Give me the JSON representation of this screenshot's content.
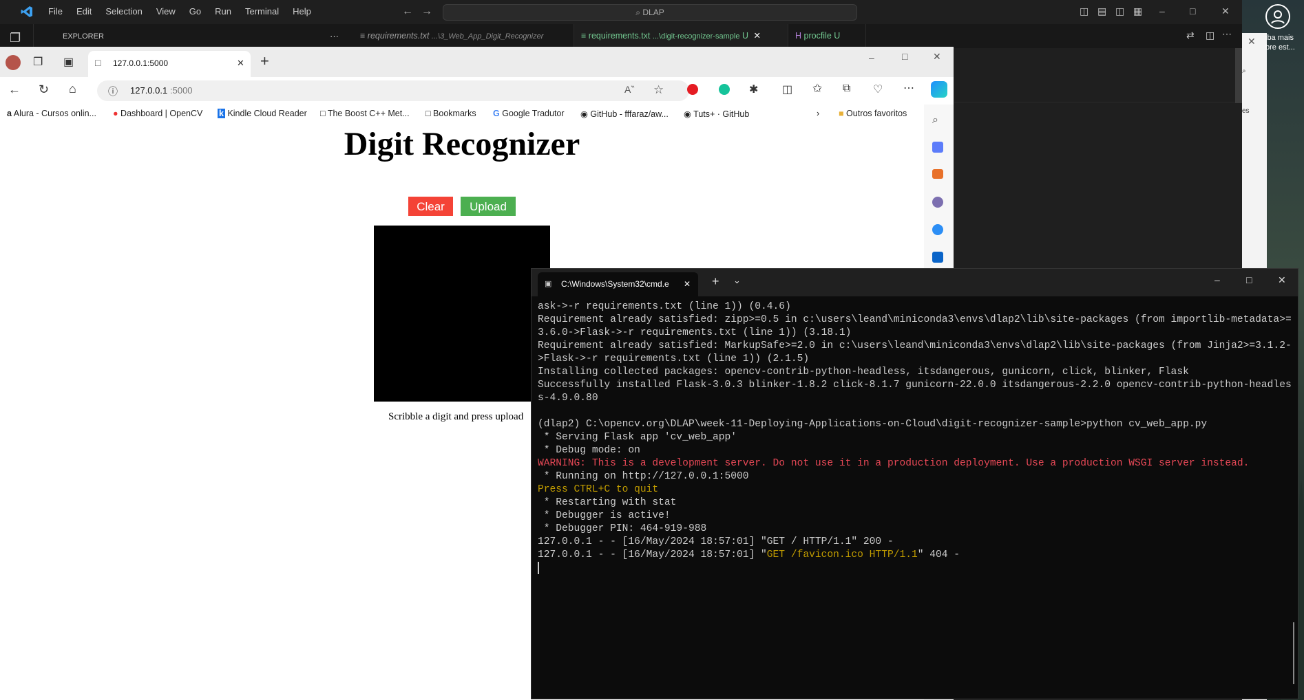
{
  "vscode": {
    "menu": [
      "File",
      "Edit",
      "Selection",
      "View",
      "Go",
      "Run",
      "Terminal",
      "Help"
    ],
    "search_text": "DLAP",
    "sidebar_title": "EXPLORER",
    "sidebar_more": "···",
    "tabs": [
      {
        "name": "requirements.txt",
        "path": "...\\3_Web_App_Digit_Recognizer",
        "status": ""
      },
      {
        "name": "requirements.txt",
        "path": "...\\digit-recognizer-sample",
        "status": "U"
      },
      {
        "name": "procfile",
        "path": "",
        "status": "U"
      }
    ],
    "accent_color": "#3ca0f0",
    "git_color": "#73c991"
  },
  "side_window": {
    "text_line1": "iba mais",
    "text_line2": "bre est...",
    "partial": "es"
  },
  "edge": {
    "tab_title": "127.0.0.1:5000",
    "url_host": "127.0.0.1",
    "url_port": ":5000",
    "bookmarks": [
      {
        "label": "Alura - Cursos onlin...",
        "icon": "alura-icon"
      },
      {
        "label": "Dashboard | OpenCV",
        "icon": "opencv-icon"
      },
      {
        "label": "Kindle Cloud Reader",
        "icon": "kindle-icon"
      },
      {
        "label": "The Boost C++ Met...",
        "icon": "page-icon"
      },
      {
        "label": "Bookmarks",
        "icon": "page-icon"
      },
      {
        "label": "Google Tradutor",
        "icon": "translate-icon"
      },
      {
        "label": "GitHub - fffaraz/aw...",
        "icon": "github-icon"
      },
      {
        "label": "Tuts+ · GitHub",
        "icon": "github-icon"
      }
    ],
    "other_favorites": "Outros favoritos"
  },
  "page": {
    "title": "Digit Recognizer",
    "clear_label": "Clear",
    "upload_label": "Upload",
    "hint": "Scribble a digit and press upload",
    "clear_color": "#f44336",
    "upload_color": "#4caf50"
  },
  "cmd": {
    "tab_title": "C:\\Windows\\System32\\cmd.e",
    "lines": [
      {
        "text": "ask->-r requirements.txt (line 1)) (0.4.6)",
        "type": "normal"
      },
      {
        "text": "Requirement already satisfied: zipp>=0.5 in c:\\users\\leand\\miniconda3\\envs\\dlap2\\lib\\site-packages (from importlib-metadata>=3.6.0->Flask->-r requirements.txt (line 1)) (3.18.1)",
        "type": "normal"
      },
      {
        "text": "Requirement already satisfied: MarkupSafe>=2.0 in c:\\users\\leand\\miniconda3\\envs\\dlap2\\lib\\site-packages (from Jinja2>=3.1.2->Flask->-r requirements.txt (line 1)) (2.1.5)",
        "type": "normal"
      },
      {
        "text": "Installing collected packages: opencv-contrib-python-headless, itsdangerous, gunicorn, click, blinker, Flask",
        "type": "normal"
      },
      {
        "text": "Successfully installed Flask-3.0.3 blinker-1.8.2 click-8.1.7 gunicorn-22.0.0 itsdangerous-2.2.0 opencv-contrib-python-headless-4.9.0.80",
        "type": "normal"
      },
      {
        "text": "",
        "type": "normal"
      },
      {
        "text": "(dlap2) C:\\opencv.org\\DLAP\\week-11-Deploying-Applications-on-Cloud\\digit-recognizer-sample>python cv_web_app.py",
        "type": "normal"
      },
      {
        "text": " * Serving Flask app 'cv_web_app'",
        "type": "normal"
      },
      {
        "text": " * Debug mode: on",
        "type": "normal"
      },
      {
        "text": "WARNING: This is a development server. Do not use it in a production deployment. Use a production WSGI server instead.",
        "type": "warn"
      },
      {
        "text": " * Running on http://127.0.0.1:5000",
        "type": "normal"
      },
      {
        "text": "Press CTRL+C to quit",
        "type": "yellow"
      },
      {
        "text": " * Restarting with stat",
        "type": "normal"
      },
      {
        "text": " * Debugger is active!",
        "type": "normal"
      },
      {
        "text": " * Debugger PIN: 464-919-988",
        "type": "normal"
      },
      {
        "text": "127.0.0.1 - - [16/May/2024 18:57:01] \"GET / HTTP/1.1\" 200 -",
        "type": "normal"
      }
    ],
    "last_line_prefix": "127.0.0.1 - - [16/May/2024 18:57:01] \"",
    "last_line_hl": "GET /favicon.ico HTTP/1.1",
    "last_line_suffix": "\" 404 -"
  }
}
